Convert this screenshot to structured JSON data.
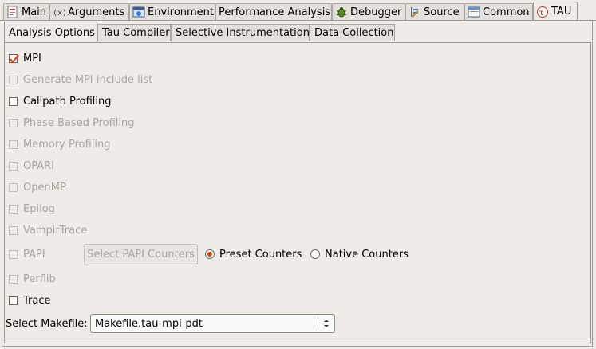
{
  "top_tabs": [
    {
      "label": "Main",
      "icon": "main-icon"
    },
    {
      "label": "Arguments",
      "icon": "arguments-icon"
    },
    {
      "label": "Environment",
      "icon": "environment-icon"
    },
    {
      "label": "Performance Analysis",
      "icon": ""
    },
    {
      "label": "Debugger",
      "icon": "debugger-bug-icon"
    },
    {
      "label": "Source",
      "icon": "source-icon"
    },
    {
      "label": "Common",
      "icon": "common-icon"
    },
    {
      "label": "TAU",
      "icon": "tau-icon"
    }
  ],
  "inner_tabs": [
    {
      "label": "Analysis Options"
    },
    {
      "label": "Tau Compiler"
    },
    {
      "label": "Selective Instrumentation"
    },
    {
      "label": "Data Collection"
    }
  ],
  "options": [
    {
      "label": "MPI",
      "checked": true,
      "enabled": true
    },
    {
      "label": "Generate MPI include list",
      "checked": false,
      "enabled": false
    },
    {
      "label": "Callpath Profiling",
      "checked": false,
      "enabled": true
    },
    {
      "label": "Phase Based Profiling",
      "checked": false,
      "enabled": false
    },
    {
      "label": "Memory Profiling",
      "checked": false,
      "enabled": false
    },
    {
      "label": "OPARI",
      "checked": false,
      "enabled": false
    },
    {
      "label": "OpenMP",
      "checked": false,
      "enabled": false
    },
    {
      "label": "Epilog",
      "checked": false,
      "enabled": false
    },
    {
      "label": "VampirTrace",
      "checked": false,
      "enabled": false
    },
    {
      "label": "PAPI",
      "checked": false,
      "enabled": false
    },
    {
      "label": "Perflib",
      "checked": false,
      "enabled": false
    },
    {
      "label": "Trace",
      "checked": false,
      "enabled": true
    }
  ],
  "papi": {
    "button_label": "Select PAPI Counters",
    "radio_preset": "Preset Counters",
    "radio_native": "Native Counters",
    "selected": "Preset Counters"
  },
  "makefile": {
    "label": "Select Makefile:",
    "value": "Makefile.tau-mpi-pdt"
  },
  "colors": {
    "check": "#d5470f",
    "background": "#efebe7",
    "disabled_text": "#a9a59f"
  }
}
